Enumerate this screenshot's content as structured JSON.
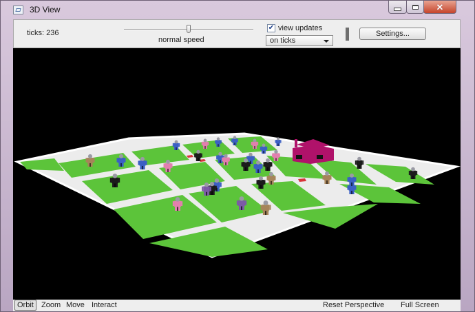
{
  "window": {
    "title": "3D View"
  },
  "toolbar": {
    "ticks_label": "ticks: 236",
    "speed_label": "normal speed",
    "speed_value": 0.5,
    "view_updates_label": "view updates",
    "view_updates_checked": true,
    "update_mode": "on ticks",
    "settings_label": "Settings..."
  },
  "bottombar": {
    "orbit": "Orbit",
    "zoom": "Zoom",
    "move": "Move",
    "interact": "Interact",
    "reset_perspective": "Reset Perspective",
    "full_screen": "Full Screen"
  },
  "scene": {
    "background_color": "#000000",
    "grass_color": "#5cc43a",
    "road_color": "#eeeeee",
    "house_color": "#b0126a",
    "person_colors": [
      "#1b1b1b",
      "#3b5fc4",
      "#e27fae",
      "#a6845a",
      "#7c5aa6"
    ]
  }
}
